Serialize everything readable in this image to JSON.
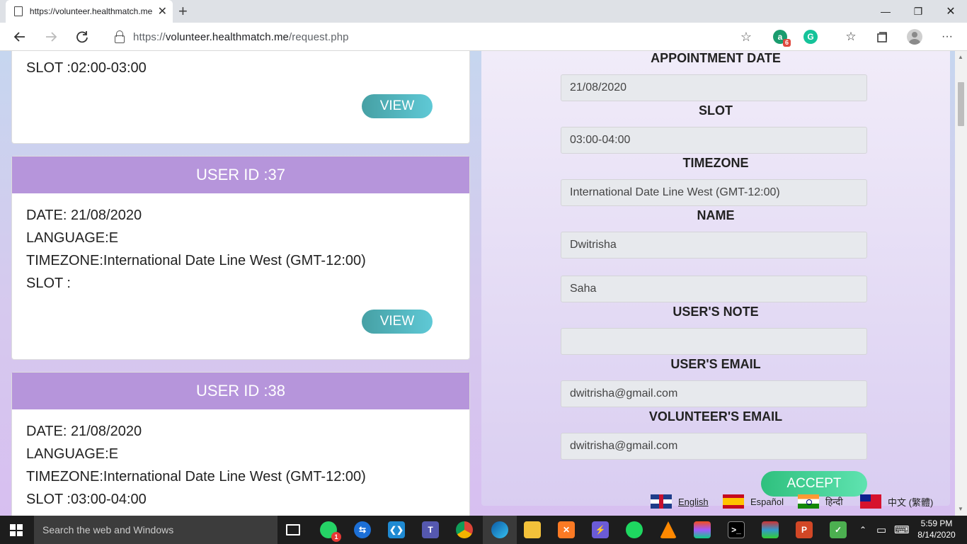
{
  "browser": {
    "tab_title": "https://volunteer.healthmatch.me",
    "tab_close": "✕",
    "new_tab": "+",
    "url_prefix": "https://",
    "url_host": "volunteer.healthmatch.me",
    "url_path": "/request.php",
    "extensions": [
      {
        "name": "a",
        "badge": "6",
        "color": "#1a9c6e"
      },
      {
        "name": "G",
        "color": "#15c39a"
      }
    ]
  },
  "cards": [
    {
      "header": "",
      "lines": [
        "SLOT :02:00-03:00"
      ],
      "view_label": "VIEW"
    },
    {
      "header": "USER ID :37",
      "lines": [
        "DATE: 21/08/2020",
        "LANGUAGE:E",
        "TIMEZONE:International Date Line West (GMT-12:00)",
        "SLOT :"
      ],
      "view_label": "VIEW"
    },
    {
      "header": "USER ID :38",
      "lines": [
        "DATE: 21/08/2020",
        "LANGUAGE:E",
        "TIMEZONE:International Date Line West (GMT-12:00)",
        "SLOT :03:00-04:00"
      ]
    }
  ],
  "form": {
    "appointment_date_label": "APPOINTMENT DATE",
    "appointment_date": "21/08/2020",
    "slot_label": "SLOT",
    "slot": "03:00-04:00",
    "timezone_label": "TIMEZONE",
    "timezone": "International Date Line West (GMT-12:00)",
    "name_label": "NAME",
    "first_name": "Dwitrisha",
    "last_name": "Saha",
    "note_label": "USER'S NOTE",
    "note": "",
    "user_email_label": "USER'S EMAIL",
    "user_email": "dwitrisha@gmail.com",
    "volunteer_email_label": "VOLUNTEER'S EMAIL",
    "volunteer_email": "dwitrisha@gmail.com",
    "accept_label": "ACCEPT"
  },
  "languages": [
    {
      "label": "English",
      "flag": "uk"
    },
    {
      "label": "Español",
      "flag": "es"
    },
    {
      "label": "हिन्दी",
      "flag": "in"
    },
    {
      "label": "中文 (繁體)",
      "flag": "tw"
    }
  ],
  "taskbar": {
    "search_placeholder": "Search the web and Windows",
    "whatsapp_badge": "1",
    "time": "5:59 PM",
    "date": "8/14/2020"
  }
}
